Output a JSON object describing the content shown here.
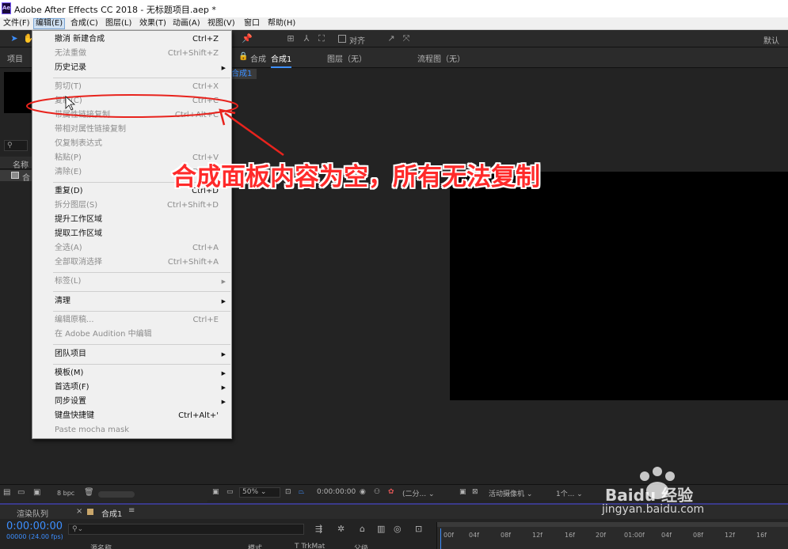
{
  "titlebar": {
    "app_icon": "Ae",
    "title": "Adobe After Effects CC 2018 - 无标题项目.aep *"
  },
  "menubar": {
    "items": [
      "文件(F)",
      "编辑(E)",
      "合成(C)",
      "图层(L)",
      "效果(T)",
      "动画(A)",
      "视图(V)",
      "窗口",
      "帮助(H)"
    ]
  },
  "toolbar": {
    "align_label": "对齐",
    "workspace_label": "默认"
  },
  "project_panel": {
    "title": "项目",
    "col_name": "名称",
    "item_abbr": "合",
    "bpc": "8 bpc"
  },
  "comp_panel": {
    "tab_label": "合成",
    "tab_name": "合成1",
    "breadcrumb": "合成1",
    "layer_tab": "图层（无）",
    "flow_tab": "流程图（无）"
  },
  "edit_menu": {
    "items": [
      {
        "label": "撤消 新建合成",
        "shortcut": "Ctrl+Z",
        "disabled": false
      },
      {
        "label": "无法重做",
        "shortcut": "Ctrl+Shift+Z",
        "disabled": true
      },
      {
        "label": "历史记录",
        "shortcut": "",
        "disabled": false,
        "submenu": true
      },
      {
        "label": "剪切(T)",
        "shortcut": "Ctrl+X",
        "disabled": true
      },
      {
        "label": "复制(C)",
        "shortcut": "Ctrl+C",
        "disabled": true
      },
      {
        "label": "带属性链接复制",
        "shortcut": "Ctrl+Alt+C",
        "disabled": true
      },
      {
        "label": "带相对属性链接复制",
        "shortcut": "",
        "disabled": true
      },
      {
        "label": "仅复制表达式",
        "shortcut": "",
        "disabled": true
      },
      {
        "label": "粘贴(P)",
        "shortcut": "Ctrl+V",
        "disabled": true
      },
      {
        "label": "清除(E)",
        "shortcut": "Delete",
        "disabled": true
      },
      {
        "label": "重复(D)",
        "shortcut": "Ctrl+D",
        "disabled": false
      },
      {
        "label": "拆分图层(S)",
        "shortcut": "Ctrl+Shift+D",
        "disabled": true
      },
      {
        "label": "提升工作区域",
        "shortcut": "",
        "disabled": false
      },
      {
        "label": "提取工作区域",
        "shortcut": "",
        "disabled": false
      },
      {
        "label": "全选(A)",
        "shortcut": "Ctrl+A",
        "disabled": true
      },
      {
        "label": "全部取消选择",
        "shortcut": "Ctrl+Shift+A",
        "disabled": true
      },
      {
        "label": "标签(L)",
        "shortcut": "",
        "disabled": true,
        "submenu": true
      },
      {
        "label": "清理",
        "shortcut": "",
        "disabled": false,
        "submenu": true
      },
      {
        "label": "编辑原稿...",
        "shortcut": "Ctrl+E",
        "disabled": true
      },
      {
        "label": "在 Adobe Audition 中编辑",
        "shortcut": "",
        "disabled": true
      },
      {
        "label": "团队项目",
        "shortcut": "",
        "disabled": false,
        "submenu": true
      },
      {
        "label": "模板(M)",
        "shortcut": "",
        "disabled": false,
        "submenu": true
      },
      {
        "label": "首选项(F)",
        "shortcut": "",
        "disabled": false,
        "submenu": true
      },
      {
        "label": "同步设置",
        "shortcut": "",
        "disabled": false,
        "submenu": true
      },
      {
        "label": "键盘快捷键",
        "shortcut": "Ctrl+Alt+'",
        "disabled": false
      },
      {
        "label": "Paste mocha mask",
        "shortcut": "",
        "disabled": true
      }
    ]
  },
  "annotation": {
    "text": "合成面板内容为空，所有无法复制",
    "color": "#ff2a2a"
  },
  "viewer_bar": {
    "zoom": "50%",
    "timecode": "0:00:00:00",
    "resolution": "(二分...",
    "camera": "活动摄像机",
    "views": "1个..."
  },
  "timeline": {
    "render_queue_tab": "渲染队列",
    "comp_tab": "合成1",
    "timecode": "0:00:00:00",
    "fps": "00000 (24.00 fps)",
    "col_source": "源名称",
    "col_mode": "模式",
    "col_trkmat": "T TrkMat",
    "col_parent": "父级",
    "ruler": [
      "00f",
      "04f",
      "08f",
      "12f",
      "16f",
      "20f",
      "01:00f",
      "04f",
      "08f",
      "12f",
      "16f"
    ]
  },
  "watermark": {
    "brand": "Baidu 经验",
    "url": "jingyan.baidu.com"
  },
  "colors": {
    "accent": "#3d8fff",
    "menu_bg": "#f0f0f0",
    "panel_bg": "#232323"
  }
}
